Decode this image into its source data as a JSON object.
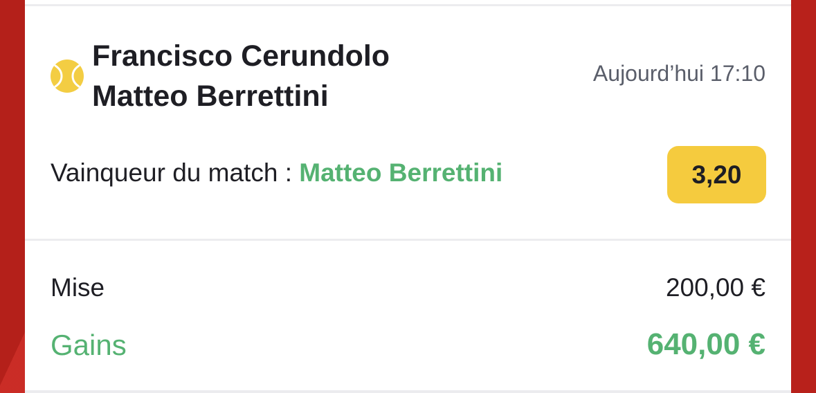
{
  "match": {
    "player_1": "Francisco Cerundolo",
    "player_2": "Matteo Berrettini",
    "time": "Aujourd’hui 17:10",
    "sport_icon": "tennis-ball-icon"
  },
  "bet": {
    "market_label": "Vainqueur du match : ",
    "selection": "Matteo Berrettini",
    "odds": "3,20"
  },
  "summary": {
    "stake_label": "Mise",
    "stake_value": "200,00 €",
    "winnings_label": "Gains",
    "winnings_value": "640,00 €"
  },
  "colors": {
    "background": "#c8241d",
    "accent_green": "#55b272",
    "odds_badge": "#f5cb3e",
    "text_dark": "#1e1e24",
    "text_muted": "#5a5e6a"
  }
}
